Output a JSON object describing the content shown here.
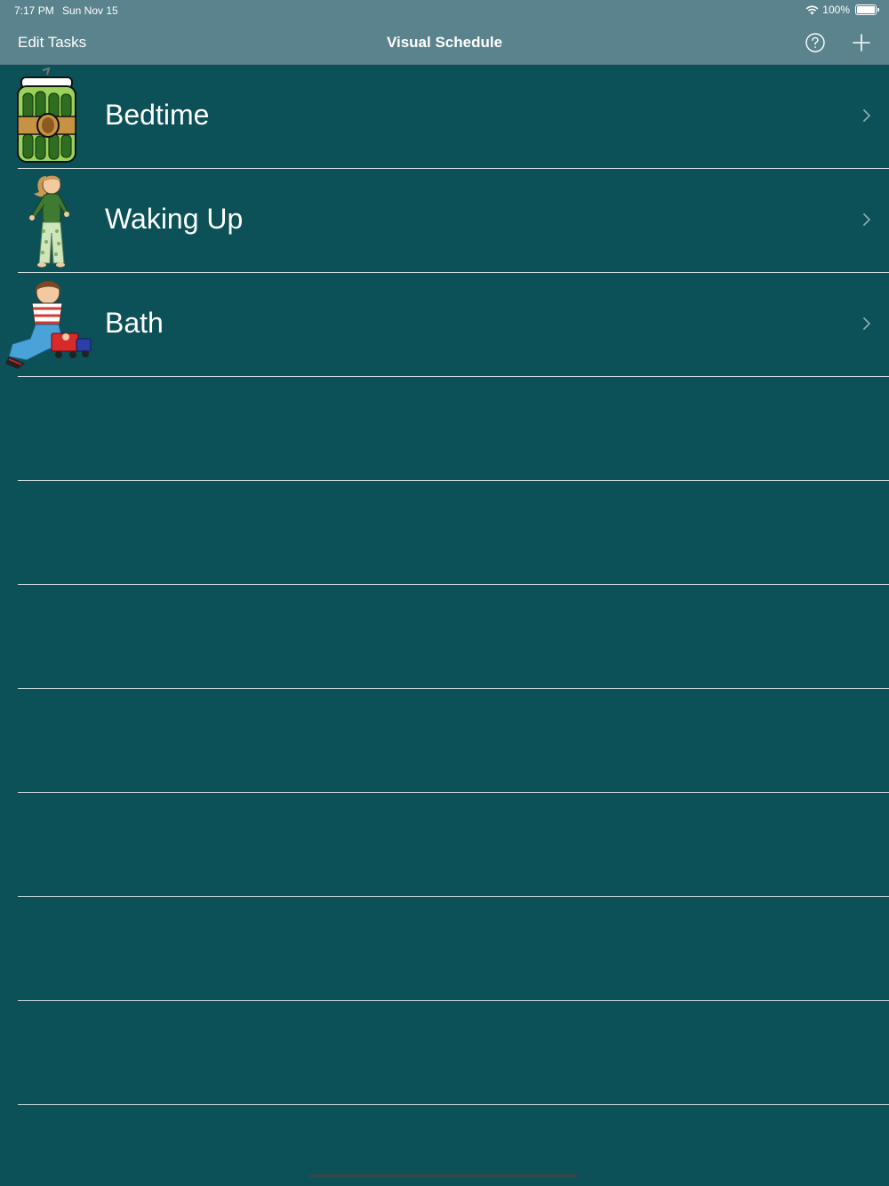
{
  "status_bar": {
    "time": "7:17 PM",
    "date": "Sun Nov 15",
    "battery": "100%",
    "wifi_icon": "wifi-icon",
    "battery_icon": "battery-icon"
  },
  "nav": {
    "left_button": "Edit Tasks",
    "title": "Visual Schedule",
    "help_icon": "question-circle-icon",
    "add_icon": "plus-icon"
  },
  "tasks": [
    {
      "label": "Bedtime",
      "image": "pickle-jar-image"
    },
    {
      "label": "Waking Up",
      "image": "girl-in-pajamas-image"
    },
    {
      "label": "Bath",
      "image": "boy-playing-with-toy-truck-image"
    }
  ],
  "colors": {
    "background": "#0b5157",
    "nav_bar": "#5a838d",
    "separator": "#cfdedf",
    "text": "#ffffff"
  }
}
